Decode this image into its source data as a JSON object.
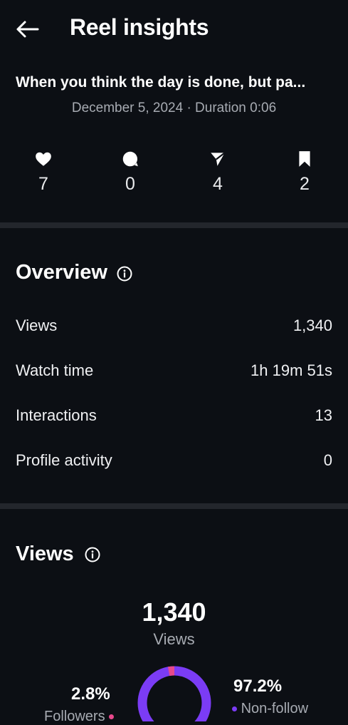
{
  "header": {
    "title": "Reel insights"
  },
  "reel": {
    "caption": "When you think the day is done, but pa...",
    "meta": "December 5, 2024 · Duration 0:06"
  },
  "stats": {
    "likes": "7",
    "comments": "0",
    "shares": "4",
    "saves": "2"
  },
  "overview": {
    "title": "Overview",
    "rows": [
      {
        "label": "Views",
        "value": "1,340"
      },
      {
        "label": "Watch time",
        "value": "1h 19m 51s"
      },
      {
        "label": "Interactions",
        "value": "13"
      },
      {
        "label": "Profile activity",
        "value": "0"
      }
    ]
  },
  "views_section": {
    "title": "Views",
    "total": "1,340",
    "total_label": "Views",
    "followers_pct": "2.8%",
    "followers_label": "Followers",
    "nonfollowers_pct": "97.2%",
    "nonfollowers_label": "Non-follow",
    "followers_fraction": 0.028,
    "followers_color": "#e8498c",
    "nonfollowers_color": "#7b3cf5"
  },
  "icons": [
    "back-arrow-icon",
    "heart-icon",
    "comment-icon",
    "share-icon",
    "bookmark-icon",
    "info-icon"
  ]
}
